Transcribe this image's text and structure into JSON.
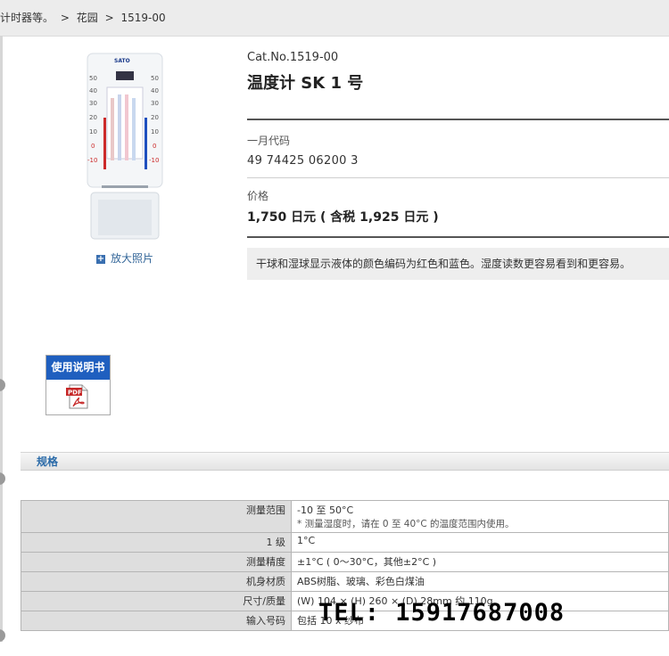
{
  "breadcrumb": {
    "items": [
      "计时器等。",
      "花园",
      "1519-00"
    ],
    "separators": [
      ">",
      ">"
    ]
  },
  "product": {
    "image_brand": "SATO",
    "zoom_link": "放大照片",
    "manual_label": "使用说明书",
    "pdf_label": "PDF",
    "cat_no": "Cat.No.1519-00",
    "title": "温度计 SK 1 号",
    "jan_label": "一月代码",
    "jan_value": "49 74425 06200 3",
    "price_label": "价格",
    "price_value": "1,750 日元 ( 含税 1,925 日元 )",
    "description": "干球和湿球显示液体的颜色编码为红色和蓝色。湿度读数更容易看到和更容易。"
  },
  "spec": {
    "header": "规格",
    "rows": [
      {
        "key": "测量范围",
        "value": "-10 至 50°C",
        "note": "* 测量湿度时，请在 0 至 40°C 的温度范围内使用。"
      },
      {
        "key": "1 级",
        "value": "1°C"
      },
      {
        "key": "测量精度",
        "value": "±1°C ( 0～30°C，其他±2°C )"
      },
      {
        "key": "机身材质",
        "value": "ABS树脂、玻璃、彩色白煤油"
      },
      {
        "key": "尺寸/质量",
        "value": "(W) 104 × (H) 260 × (D) 28mm 约 110g"
      },
      {
        "key": "输入号码",
        "value": "包括 10 x 纱布"
      }
    ]
  },
  "overlay": {
    "tel": "TEL:  15917687008"
  },
  "colors": {
    "link_blue": "#336699",
    "manual_blue": "#1f5fbf",
    "spec_header_blue": "#2a6aa8"
  }
}
